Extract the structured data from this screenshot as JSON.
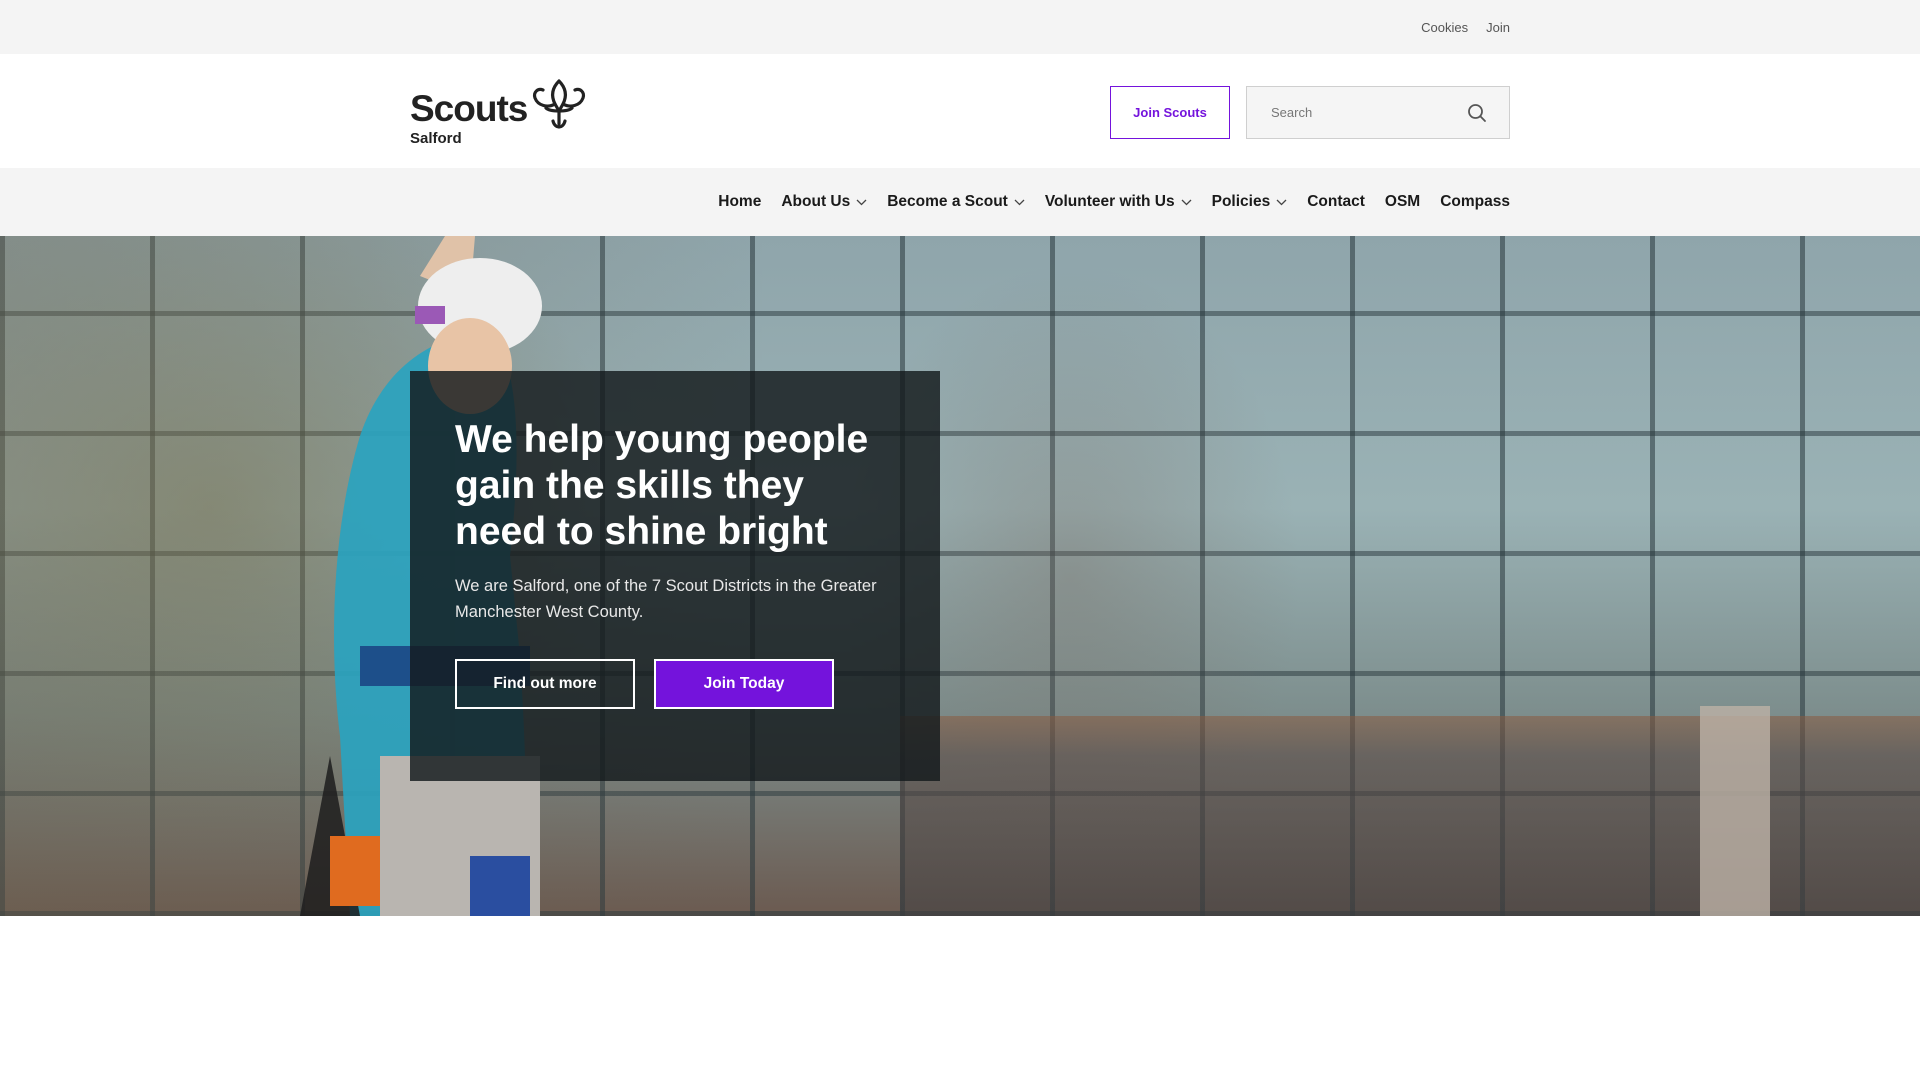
{
  "utility": {
    "links": [
      "Cookies",
      "Join"
    ]
  },
  "header": {
    "logo_word": "Scouts",
    "logo_sub": "Salford",
    "join_button": "Join Scouts",
    "search_placeholder": "Search"
  },
  "nav": {
    "items": [
      {
        "label": "Home",
        "dropdown": false
      },
      {
        "label": "About Us",
        "dropdown": true
      },
      {
        "label": "Become a Scout",
        "dropdown": true
      },
      {
        "label": "Volunteer with Us",
        "dropdown": true
      },
      {
        "label": "Policies",
        "dropdown": true
      },
      {
        "label": "Contact",
        "dropdown": false
      },
      {
        "label": "OSM",
        "dropdown": false
      },
      {
        "label": "Compass",
        "dropdown": false
      }
    ]
  },
  "hero": {
    "title": "We help young people gain the skills they need to shine bright",
    "subtitle": "We are Salford, one of the 7 Scout Districts in the Greater Manchester West County.",
    "secondary_button": "Find out more",
    "primary_button": "Join Today"
  },
  "colors": {
    "brand_purple": "#7413dc",
    "utility_bg": "#f4f4f4",
    "panel_bg": "#141a1c"
  }
}
